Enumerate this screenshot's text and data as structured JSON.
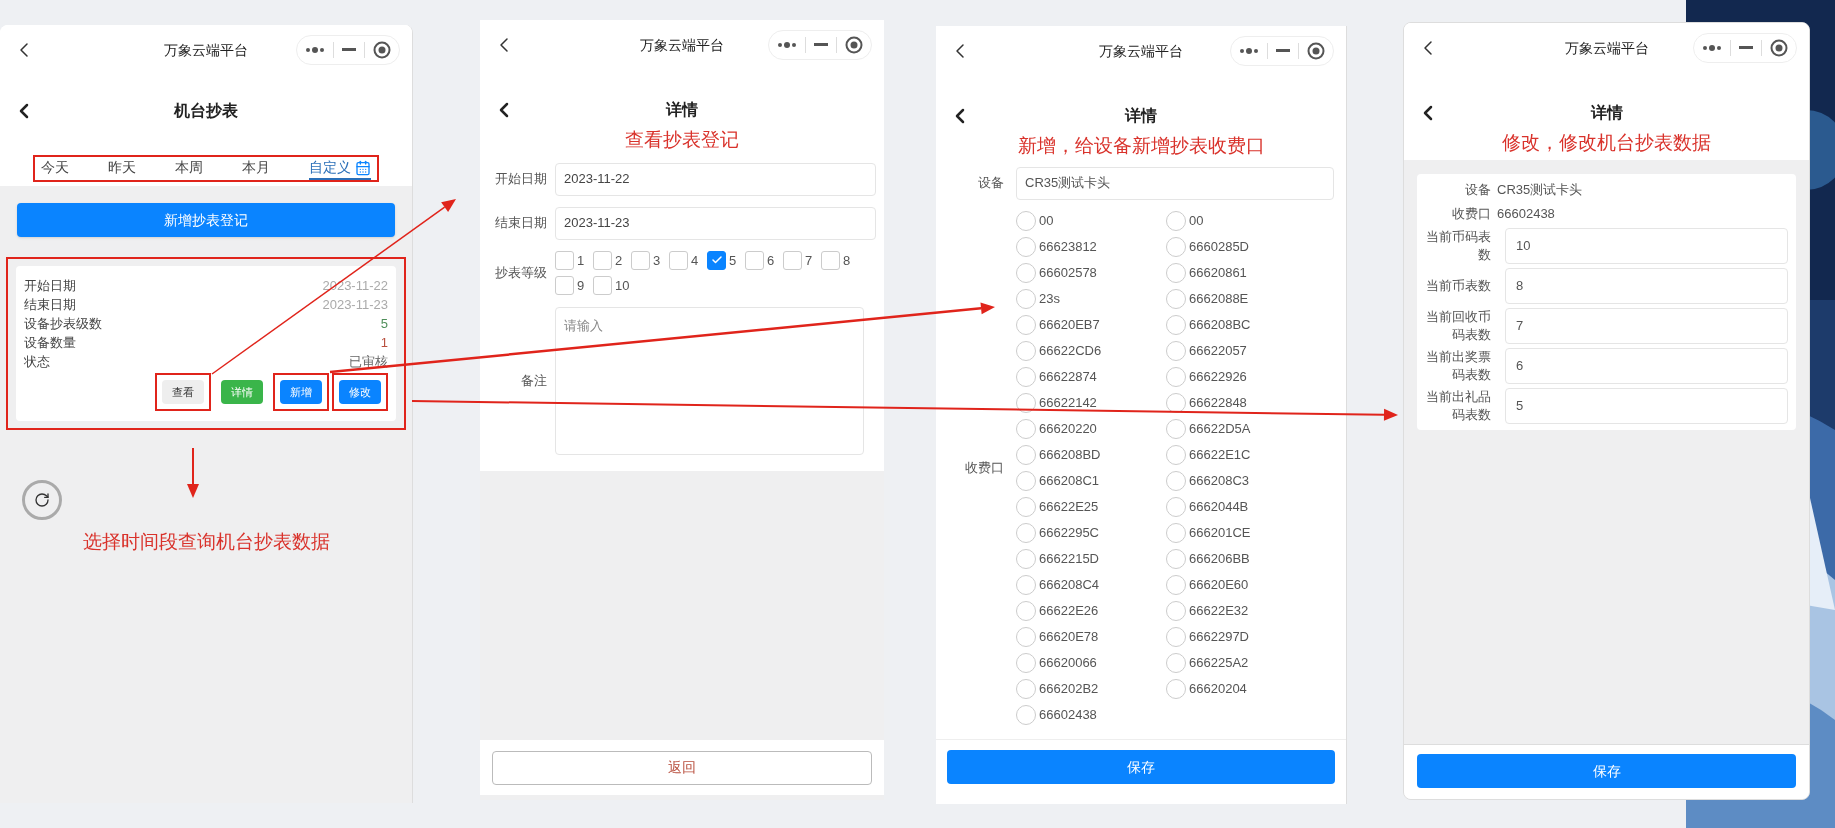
{
  "list_screen": {
    "window_title": "万象云端平台",
    "page_title": "机台抄表",
    "tabs": [
      {
        "label": "今天",
        "selected": false
      },
      {
        "label": "昨天",
        "selected": false
      },
      {
        "label": "本周",
        "selected": false
      },
      {
        "label": "本月",
        "selected": false
      },
      {
        "label": "自定义",
        "selected": true
      }
    ],
    "add_button": "新增抄表登记",
    "fields": [
      {
        "label": "开始日期",
        "value": "2023-11-22",
        "color": "#aaaaaa"
      },
      {
        "label": "结束日期",
        "value": "2023-11-23",
        "color": "#aaaaaa"
      },
      {
        "label": "设备抄表级数",
        "value": "5",
        "color": "#4f8f5a"
      },
      {
        "label": "设备数量",
        "value": "1",
        "color": "#b9503f"
      },
      {
        "label": "状态",
        "value": "已审核",
        "color": "#666666"
      }
    ],
    "actions": [
      {
        "label": "查看",
        "color": "#eeeeee",
        "highlighted": true
      },
      {
        "label": "详情",
        "color": "#3ab54a",
        "highlighted": false
      },
      {
        "label": "新增",
        "color": "#0a84ff",
        "highlighted": true
      },
      {
        "label": "修改",
        "color": "#0a84ff",
        "highlighted": true
      }
    ],
    "caption": "选择时间段查询机台抄表数据"
  },
  "view_screen": {
    "window_title": "万象云端平台",
    "page_title": "详情",
    "caption": "查看抄表登记",
    "start_label": "开始日期",
    "start_value": "2023-11-22",
    "end_label": "结束日期",
    "end_value": "2023-11-23",
    "level_label": "抄表等级",
    "levels": [
      {
        "label": "1",
        "checked": false
      },
      {
        "label": "2",
        "checked": false
      },
      {
        "label": "3",
        "checked": false
      },
      {
        "label": "4",
        "checked": false
      },
      {
        "label": "5",
        "checked": true
      },
      {
        "label": "6",
        "checked": false
      },
      {
        "label": "7",
        "checked": false
      },
      {
        "label": "8",
        "checked": false
      },
      {
        "label": "9",
        "checked": false
      },
      {
        "label": "10",
        "checked": false
      }
    ],
    "remark_label": "备注",
    "remark_placeholder": "请输入",
    "back_button": "返回"
  },
  "add_screen": {
    "window_title": "万象云端平台",
    "page_title": "详情",
    "caption": "新增，给设备新增抄表收费口",
    "device_label": "设备",
    "device_value": "CR35测试卡头",
    "port_label": "收费口",
    "ports": [
      {
        "label": "00",
        "selected": false
      },
      {
        "label": "00",
        "selected": false
      },
      {
        "label": "66623812",
        "selected": false
      },
      {
        "label": "6660285D",
        "selected": false
      },
      {
        "label": "66602578",
        "selected": false
      },
      {
        "label": "66620861",
        "selected": false
      },
      {
        "label": "23s",
        "selected": false
      },
      {
        "label": "6662088E",
        "selected": false
      },
      {
        "label": "66620EB7",
        "selected": false
      },
      {
        "label": "666208BC",
        "selected": false
      },
      {
        "label": "66622CD6",
        "selected": false
      },
      {
        "label": "66622057",
        "selected": false
      },
      {
        "label": "66622874",
        "selected": false
      },
      {
        "label": "66622926",
        "selected": false
      },
      {
        "label": "66622142",
        "selected": false
      },
      {
        "label": "66622848",
        "selected": false
      },
      {
        "label": "66620220",
        "selected": false
      },
      {
        "label": "66622D5A",
        "selected": false
      },
      {
        "label": "666208BD",
        "selected": false
      },
      {
        "label": "66622E1C",
        "selected": false
      },
      {
        "label": "666208C1",
        "selected": false
      },
      {
        "label": "666208C3",
        "selected": false
      },
      {
        "label": "66622E25",
        "selected": false
      },
      {
        "label": "6662044B",
        "selected": false
      },
      {
        "label": "6662295C",
        "selected": false
      },
      {
        "label": "666201CE",
        "selected": false
      },
      {
        "label": "6662215D",
        "selected": false
      },
      {
        "label": "666206BB",
        "selected": false
      },
      {
        "label": "666208C4",
        "selected": false
      },
      {
        "label": "66620E60",
        "selected": false
      },
      {
        "label": "66622E26",
        "selected": false
      },
      {
        "label": "66622E32",
        "selected": false
      },
      {
        "label": "66620E78",
        "selected": false
      },
      {
        "label": "6662297D",
        "selected": false
      },
      {
        "label": "66620066",
        "selected": false
      },
      {
        "label": "666225A2",
        "selected": false
      },
      {
        "label": "666202B2",
        "selected": false
      },
      {
        "label": "66620204",
        "selected": false
      },
      {
        "label": "66602438",
        "selected": false
      }
    ],
    "save_button": "保存"
  },
  "edit_screen": {
    "window_title": "万象云端平台",
    "page_title": "详情",
    "caption": "修改，修改机台抄表数据",
    "info": [
      {
        "label": "设备",
        "value": "CR35测试卡头"
      },
      {
        "label": "收费口",
        "value": "66602438"
      }
    ],
    "fields": [
      {
        "label": "当前币码表数",
        "value": "10"
      },
      {
        "label": "当前币表数",
        "value": "8"
      },
      {
        "label": "当前回收币码表数",
        "value": "7"
      },
      {
        "label": "当前出奖票码表数",
        "value": "6"
      },
      {
        "label": "当前出礼品码表数",
        "value": "5"
      }
    ],
    "save_button": "保存"
  }
}
